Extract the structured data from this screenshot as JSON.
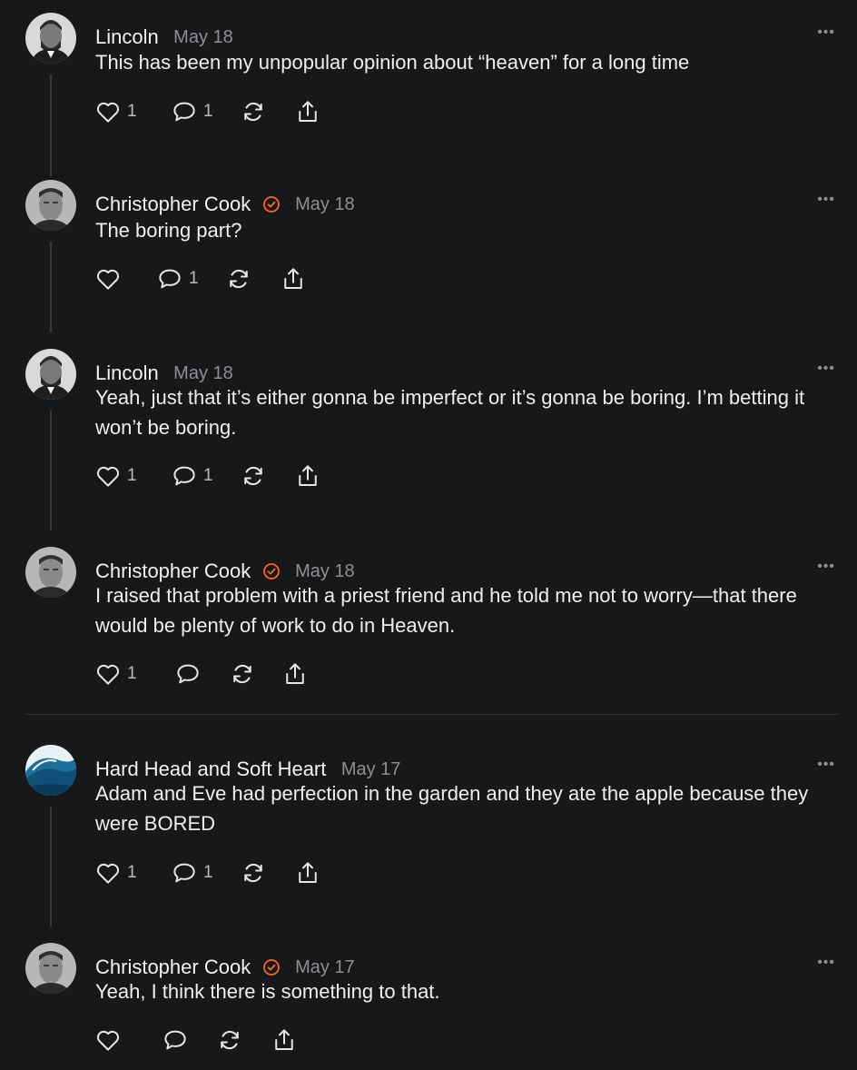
{
  "comments": [
    {
      "author": "Lincoln",
      "date": "May 18",
      "verified": false,
      "avatar_icon": "lincoln-portrait-avatar",
      "text": "This has been my unpopular opinion about “heaven” for a long time",
      "likes": "1",
      "replies": "1",
      "more_label": "•••"
    },
    {
      "author": "Christopher Cook",
      "date": "May 18",
      "verified": true,
      "avatar_icon": "christopher-cook-avatar",
      "text": "The boring part?",
      "likes": "",
      "replies": "1",
      "more_label": "•••"
    },
    {
      "author": "Lincoln",
      "date": "May 18",
      "verified": false,
      "avatar_icon": "lincoln-portrait-avatar",
      "text": "Yeah, just that it’s either gonna be imperfect or it’s gonna be boring. I’m betting it won’t be boring.",
      "likes": "1",
      "replies": "1",
      "more_label": "•••"
    },
    {
      "author": "Christopher Cook",
      "date": "May 18",
      "verified": true,
      "avatar_icon": "christopher-cook-avatar",
      "text": "I raised that problem with a priest friend and he told me not to worry—that there would be plenty of work to do in Heaven.",
      "likes": "1",
      "replies": "",
      "more_label": "•••"
    },
    {
      "author": "Hard Head and Soft Heart",
      "date": "May 17",
      "verified": false,
      "avatar_icon": "ocean-wave-avatar",
      "text": "Adam and Eve had perfection in the garden and they ate the apple because they were BORED",
      "likes": "1",
      "replies": "1",
      "more_label": "•••"
    },
    {
      "author": "Christopher Cook",
      "date": "May 17",
      "verified": true,
      "avatar_icon": "christopher-cook-avatar",
      "text": "Yeah, I think there is something to that.",
      "likes": "",
      "replies": "",
      "more_label": "•••"
    }
  ],
  "colors": {
    "background": "#17181a",
    "text": "#efefef",
    "muted": "#8e8f93",
    "verified_badge": "#ff6719",
    "thread_line": "#3a3b3e"
  }
}
